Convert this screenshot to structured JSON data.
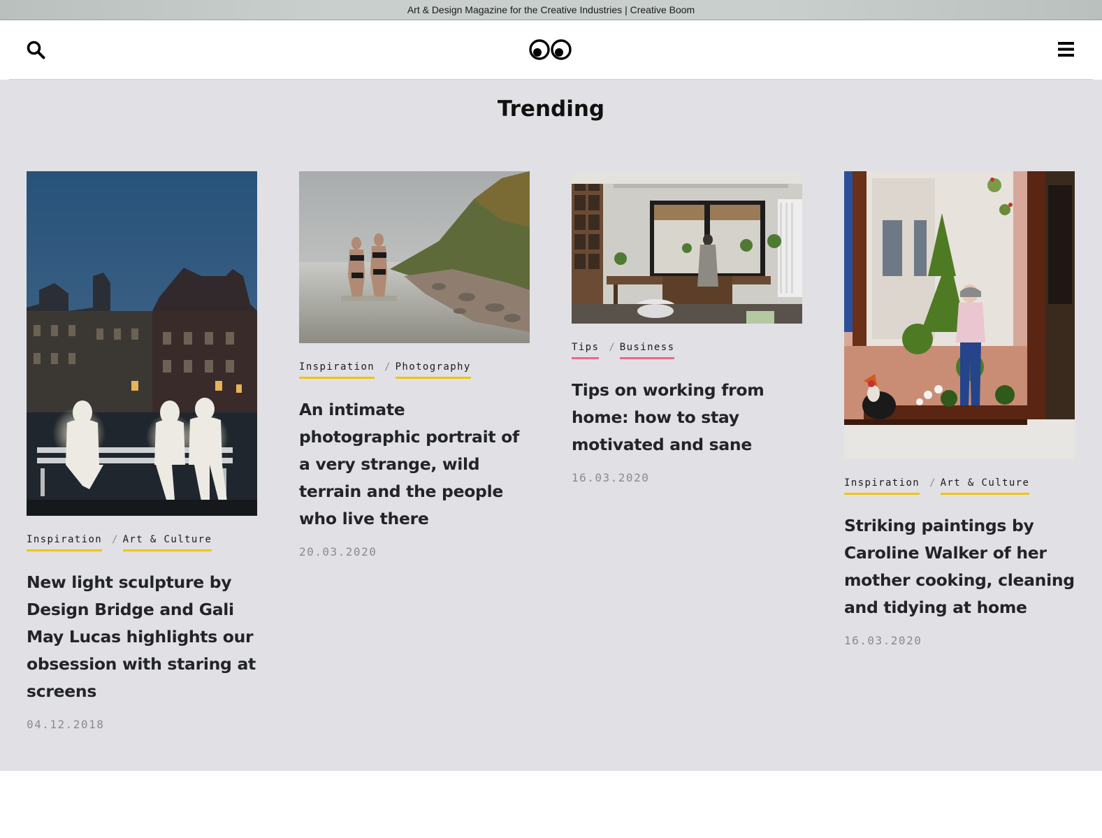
{
  "window": {
    "title": "Art & Design Magazine for the Creative Industries | Creative Boom"
  },
  "header": {
    "search_icon": "search-icon",
    "logo": "creative-boom-eyes-logo",
    "menu_icon": "hamburger-menu-icon"
  },
  "section": {
    "title": "Trending"
  },
  "colors": {
    "tag_yellow": "#f1c40f",
    "tag_pink": "#e8688b",
    "background": "#e1e1e5"
  },
  "articles": [
    {
      "tags": [
        "Inspiration",
        "Art & Culture"
      ],
      "separator": "/",
      "headline": "New light sculpture by Design Bridge and Gali May Lucas highlights our obsession with staring at screens",
      "date": "04.12.2018"
    },
    {
      "tags": [
        "Inspiration",
        "Photography"
      ],
      "separator": "/",
      "headline": "An intimate photographic portrait of a very strange, wild terrain and the people who live there",
      "date": "20.03.2020"
    },
    {
      "tags": [
        "Tips",
        "Business"
      ],
      "separator": "/",
      "headline": "Tips on working from home: how to stay motivated and sane",
      "date": "16.03.2020"
    },
    {
      "tags": [
        "Inspiration",
        "Art & Culture"
      ],
      "separator": "/",
      "headline": "Striking paintings by Caroline Walker of her mother cooking, cleaning and tidying at home",
      "date": "16.03.2020"
    }
  ]
}
